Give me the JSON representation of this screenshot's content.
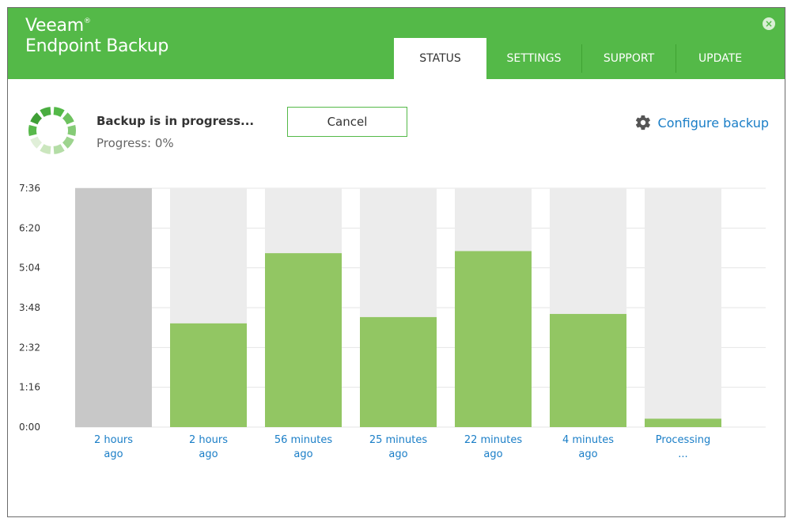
{
  "app": {
    "brand_line1": "Veeam",
    "brand_mark": "®",
    "brand_line2": "Endpoint Backup",
    "close_glyph": "×"
  },
  "tabs": [
    {
      "label": "STATUS",
      "active": true
    },
    {
      "label": "SETTINGS",
      "active": false
    },
    {
      "label": "SUPPORT",
      "active": false
    },
    {
      "label": "UPDATE",
      "active": false
    }
  ],
  "status": {
    "title": "Backup is in progress...",
    "progress_text": "Progress: 0%",
    "progress_value": 0,
    "cancel_label": "Cancel",
    "configure_label": "Configure backup"
  },
  "colors": {
    "header_green": "#54b948",
    "bar_green": "#92c663",
    "bar_gray": "#c8c8c8",
    "bar_track": "#ececec",
    "link_blue": "#1a7ec7",
    "axis_text": "#333333",
    "grid": "#e6e6e6"
  },
  "icons": {
    "spinner": "loading-spinner-icon",
    "configure": "gear-icon",
    "close": "close-icon"
  },
  "chart_data": {
    "type": "bar",
    "y_axis_unit": "duration (m:ss)",
    "y_ticks": [
      "0:00",
      "1:16",
      "2:32",
      "3:48",
      "5:04",
      "6:20",
      "7:36"
    ],
    "y_tick_seconds": [
      0,
      76,
      152,
      228,
      304,
      380,
      456
    ],
    "ylim_seconds": [
      0,
      456
    ],
    "categories": [
      "2 hours\nago",
      "2 hours\nago",
      "56 minutes\nago",
      "25 minutes\nago",
      "22 minutes\nago",
      "4 minutes\nago",
      "Processing\n..."
    ],
    "values_seconds": [
      456,
      198,
      332,
      210,
      336,
      216,
      16
    ],
    "bar_states": [
      "gray",
      "green",
      "green",
      "green",
      "green",
      "green",
      "green"
    ],
    "grid": true,
    "legend": "none"
  }
}
